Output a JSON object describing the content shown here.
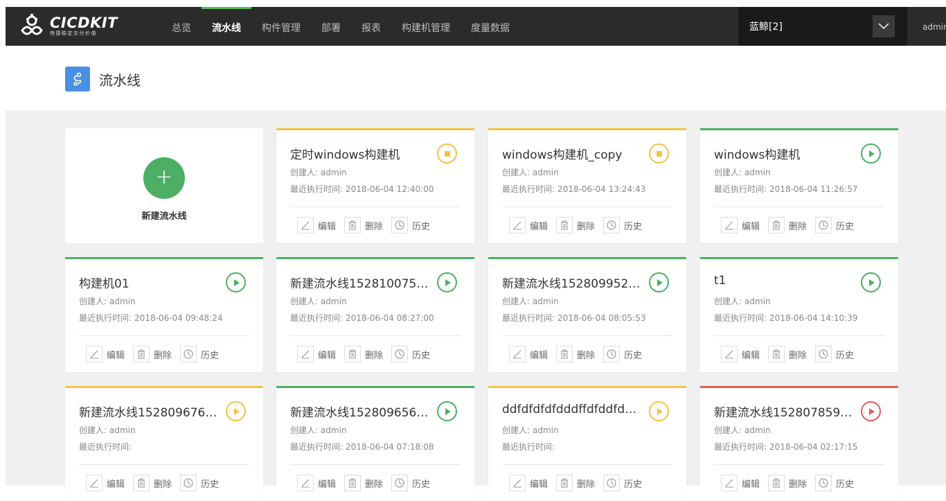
{
  "app": {
    "logo_name": "CICDKIT",
    "logo_sub": "快捷稳定交付价值",
    "nav": [
      "总览",
      "流水线",
      "构件管理",
      "部署",
      "报表",
      "构建机管理",
      "度量数据"
    ],
    "active_nav": 1,
    "tenant": "蓝鲸[2]",
    "user": "admin"
  },
  "page": {
    "title": "流水线",
    "new_label": "新建流水线"
  },
  "labels": {
    "creator": "创建人:",
    "last_run": "最近执行时间:",
    "edit": "编辑",
    "delete": "删除",
    "history": "历史"
  },
  "colors": {
    "running": "#f5c245",
    "success": "#4caf63",
    "failed": "#e85a5a"
  },
  "pipelines": [
    {
      "name": "定时windows构建机",
      "creator": "admin",
      "last_run": "2018-06-04 12:40:00",
      "status": "running",
      "action_icon": "stop-icon"
    },
    {
      "name": "windows构建机_copy",
      "creator": "admin",
      "last_run": "2018-06-04 13:24:43",
      "status": "running",
      "action_icon": "stop-icon"
    },
    {
      "name": "windows构建机",
      "creator": "admin",
      "last_run": "2018-06-04 11:26:57",
      "status": "success",
      "action_icon": "play-icon"
    },
    {
      "name": "构建机01",
      "creator": "admin",
      "last_run": "2018-06-04 09:48:24",
      "status": "success",
      "action_icon": "play-icon"
    },
    {
      "name": "新建流水线152810075…",
      "creator": "admin",
      "last_run": "2018-06-04 08:27:00",
      "status": "success",
      "action_icon": "play-icon"
    },
    {
      "name": "新建流水线152809952…",
      "creator": "admin",
      "last_run": "2018-06-04 08:05:53",
      "status": "success",
      "action_icon": "play-icon"
    },
    {
      "name": "t1",
      "creator": "admin",
      "last_run": "2018-06-04 14:10:39",
      "status": "success",
      "action_icon": "play-icon"
    },
    {
      "name": "新建流水线152809676…",
      "creator": "admin",
      "last_run": "",
      "status": "running",
      "action_icon": "play-icon"
    },
    {
      "name": "新建流水线152809656…",
      "creator": "admin",
      "last_run": "2018-06-04 07:18:08",
      "status": "success",
      "action_icon": "play-icon"
    },
    {
      "name": "ddfdfdfdfdddffdfddfdff…",
      "creator": "admin",
      "last_run": "",
      "status": "running",
      "action_icon": "play-icon"
    },
    {
      "name": "新建流水线152807859…",
      "creator": "admin",
      "last_run": "2018-06-04 02:17:15",
      "status": "failed",
      "action_icon": "play-icon"
    }
  ]
}
